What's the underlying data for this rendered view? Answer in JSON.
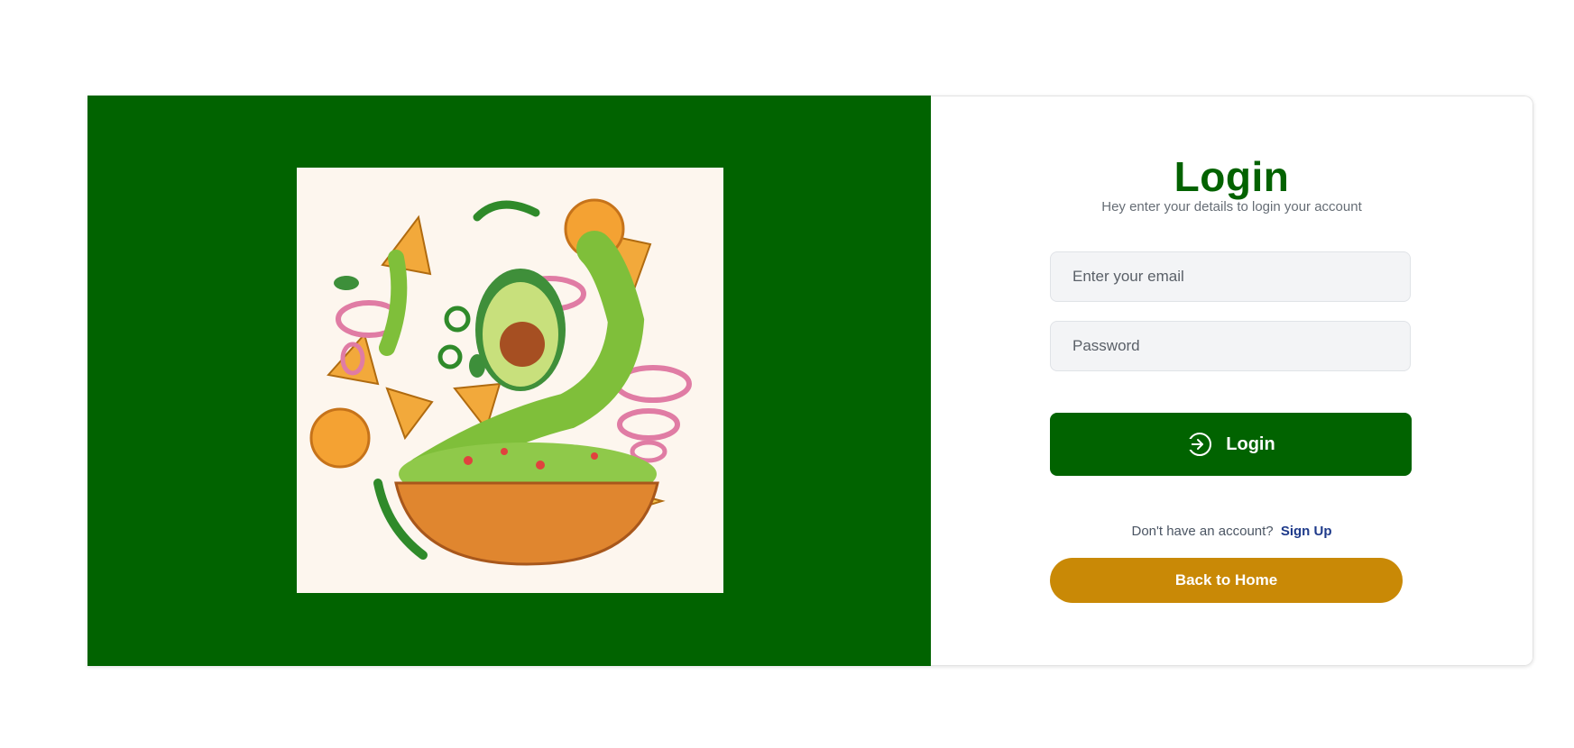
{
  "login_panel": {
    "title": "Login",
    "subtitle": "Hey enter your details to login your account",
    "email_placeholder": "Enter your email",
    "password_placeholder": "Password",
    "login_button_label": "Login",
    "signup_prompt": "Don't have an account?",
    "signup_link": "Sign Up",
    "back_home_label": "Back to Home"
  },
  "icons": {
    "login_button": "login-arrow-icon"
  },
  "colors": {
    "brand_green": "#016300",
    "accent_gold": "#c98906",
    "link_blue": "#1e3a8a"
  }
}
